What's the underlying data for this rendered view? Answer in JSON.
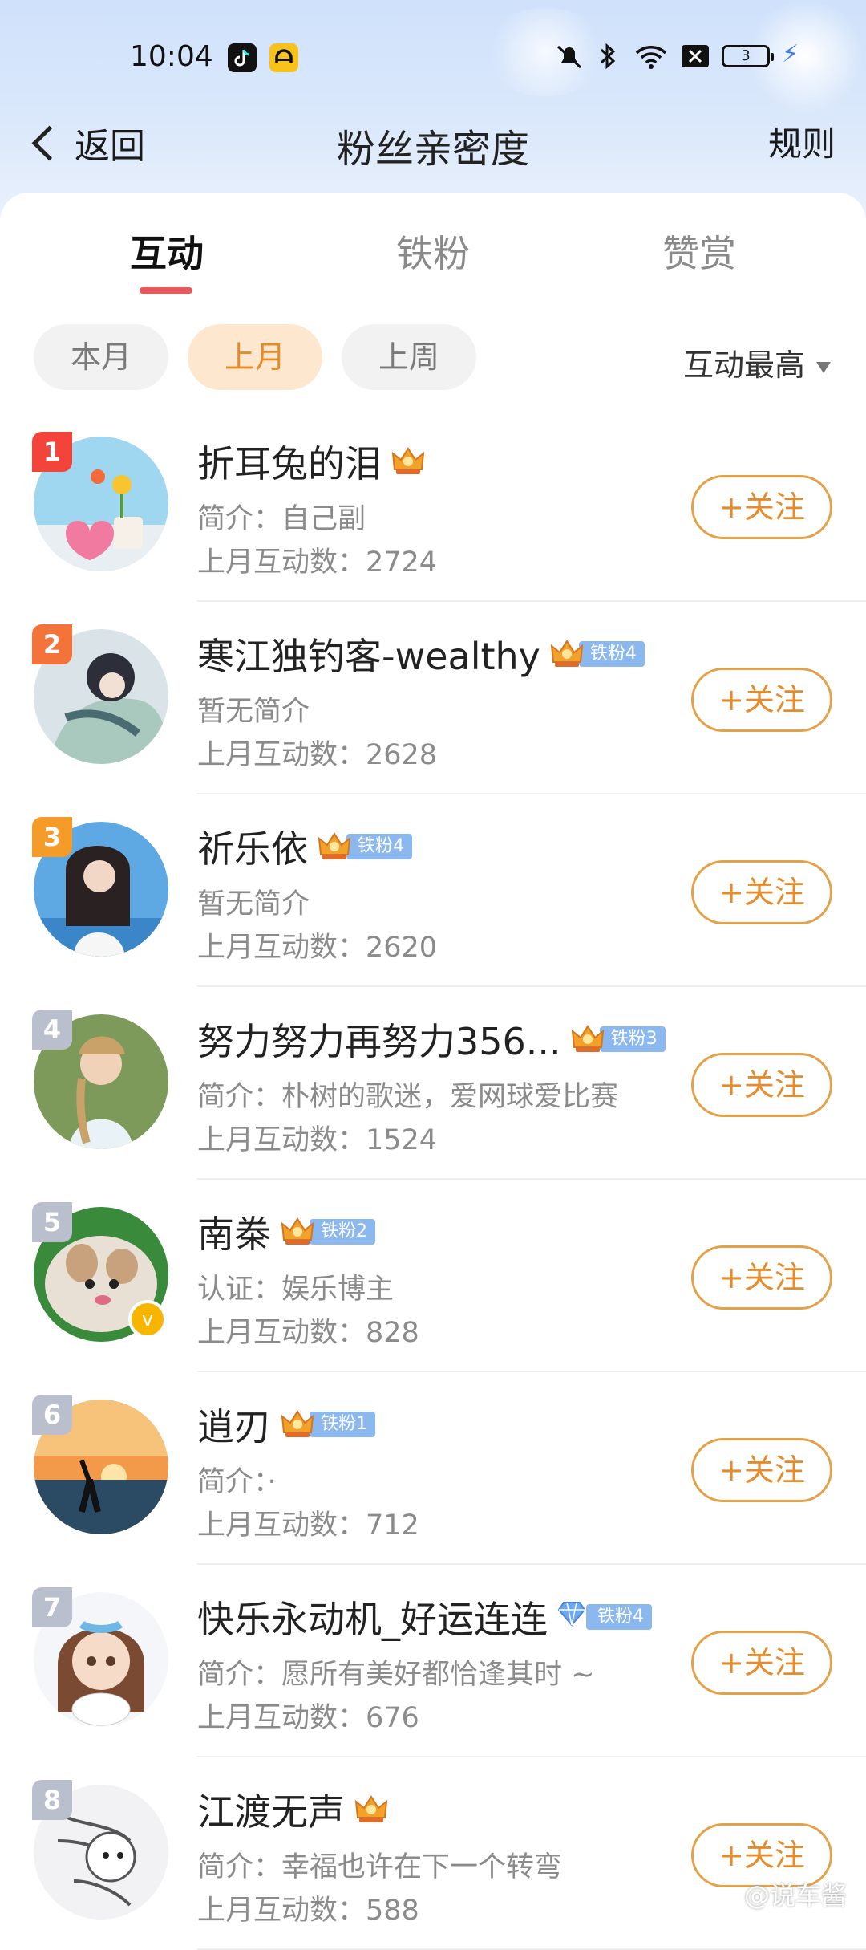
{
  "status": {
    "time": "10:04",
    "battery": "3"
  },
  "header": {
    "back": "返回",
    "title": "粉丝亲密度",
    "rules": "规则"
  },
  "tabs": [
    {
      "label": "互动",
      "active": true
    },
    {
      "label": "铁粉",
      "active": false
    },
    {
      "label": "赞赏",
      "active": false
    }
  ],
  "filters": [
    {
      "label": "本月",
      "active": false
    },
    {
      "label": "上月",
      "active": true
    },
    {
      "label": "上周",
      "active": false
    }
  ],
  "sort_label": "互动最高",
  "follow_label": "+关注",
  "colors": {
    "accent_orange": "#e58b2a",
    "tab_underline": "#e9585a",
    "rank1": "#f2443a",
    "rank2": "#f4733b",
    "rank3": "#f59b2a",
    "rank_other": "#b9bfcc"
  },
  "fans": [
    {
      "rank": "1",
      "name": "折耳兔的泪",
      "crown_level": "6",
      "fan_badge": "",
      "bio": "简介：自己副",
      "count": "上月互动数：2724"
    },
    {
      "rank": "2",
      "name": "寒江独钓客-wealthy",
      "crown_level": "5",
      "fan_badge": "铁粉4",
      "bio": "暂无简介",
      "count": "上月互动数：2628"
    },
    {
      "rank": "3",
      "name": "祈乐依",
      "crown_level": "5",
      "fan_badge": "铁粉4",
      "bio": "暂无简介",
      "count": "上月互动数：2620"
    },
    {
      "rank": "4",
      "name": "努力努力再努力356...",
      "crown_level": "5",
      "fan_badge": "铁粉3",
      "bio": "简介：朴树的歌迷，爱网球爱比赛",
      "count": "上月互动数：1524"
    },
    {
      "rank": "5",
      "name": "南桊",
      "crown_level": "5",
      "fan_badge": "铁粉2",
      "bio": "认证：娱乐博主",
      "count": "上月互动数：828"
    },
    {
      "rank": "6",
      "name": "逍刃",
      "crown_level": "4",
      "fan_badge": "铁粉1",
      "bio": "简介：·",
      "count": "上月互动数：712"
    },
    {
      "rank": "7",
      "name": "快乐永动机_好运连连",
      "crown_level": "",
      "fan_badge": "铁粉4",
      "bio": "简介：愿所有美好都恰逢其时 ~",
      "count": "上月互动数：676"
    },
    {
      "rank": "8",
      "name": "江渡无声",
      "crown_level": "4",
      "fan_badge": "",
      "bio": "简介：幸福也许在下一个转弯",
      "count": "上月互动数：588"
    }
  ],
  "watermark": "@说车酱"
}
